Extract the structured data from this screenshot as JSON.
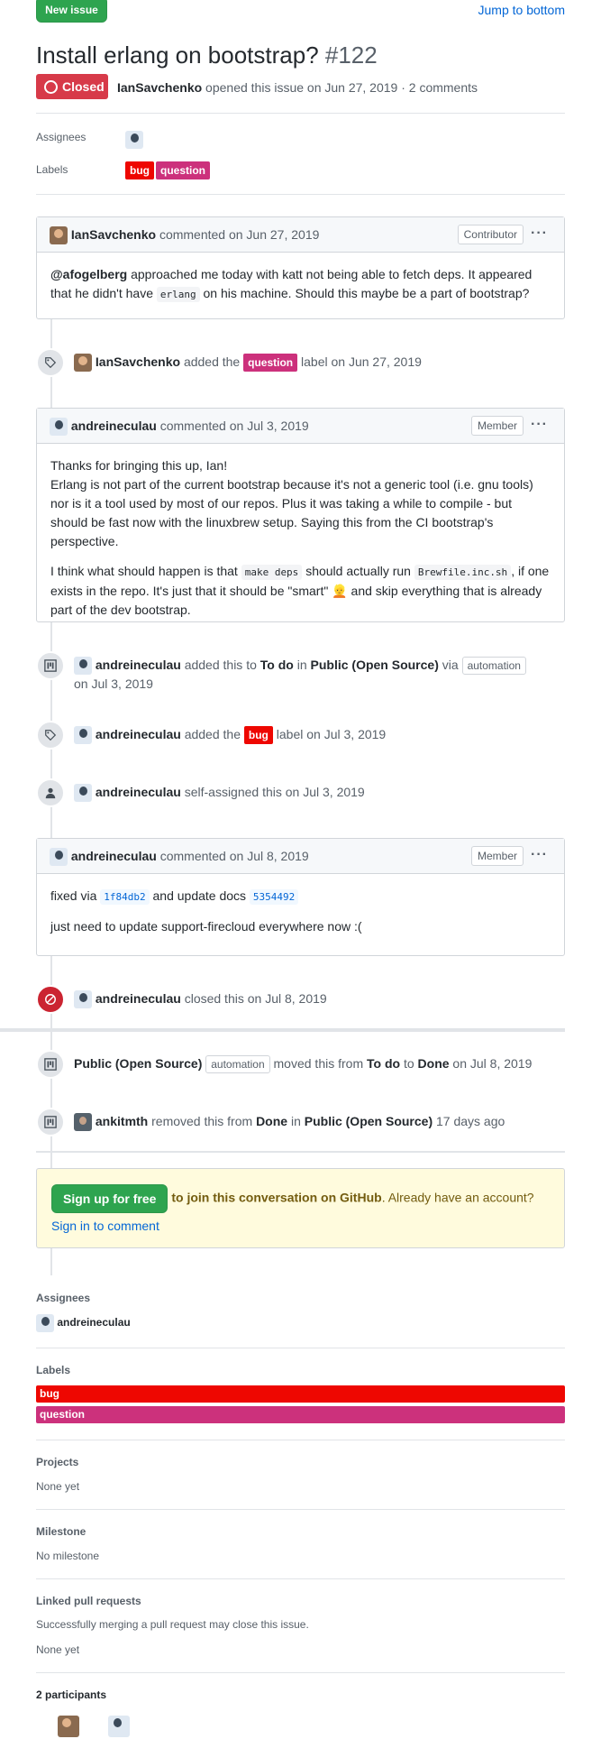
{
  "header": {
    "new_issue_label": "New issue",
    "jump_label": "Jump to bottom",
    "title": "Install erlang on bootstrap?",
    "number": "#122",
    "state_label": "Closed",
    "author": "IanSavchenko",
    "meta": "opened this issue on Jun 27, 2019 · 2 comments"
  },
  "top_meta": {
    "assignees_label": "Assignees",
    "labels_label": "Labels",
    "labels": [
      {
        "name": "bug",
        "color": "#ee0701"
      },
      {
        "name": "question",
        "color": "#cc317c"
      }
    ]
  },
  "comment1": {
    "author": "IanSavchenko",
    "when": "commented on Jun 27, 2019",
    "badge": "Contributor",
    "mention": "@afogelberg",
    "t1": "approached me today with katt not being able to fetch deps. It appeared that he didn't have",
    "code1": "erlang",
    "t2": "on his machine. Should this maybe be a part of bootstrap?"
  },
  "event_label_question": {
    "author": "IanSavchenko",
    "t1": "added the",
    "label": "question",
    "t2": "label on Jun 27, 2019"
  },
  "comment2": {
    "author": "andreineculau",
    "when": "commented on Jul 3, 2019",
    "badge": "Member",
    "p1a": "Thanks for bringing this up, Ian!",
    "p1b": "Erlang is not part of the current bootstrap because it's not a generic tool (i.e. gnu tools) nor is it a tool used by most of our repos. Plus it was taking a while to compile - but should be fast now with the linuxbrew setup. Saying this from the CI bootstrap's perspective.",
    "p2a": "I think what should happen is that",
    "p2code1": "make deps",
    "p2b": "should actually run",
    "p2code2": "Brewfile.inc.sh",
    "p2c": ", if one exists in the repo. It's just that it should be \"smart\"",
    "emoji": "👱",
    "p2d": "and skip everything that is already part of the dev bootstrap."
  },
  "event_project_add": {
    "author": "andreineculau",
    "t1": "added this to",
    "column": "To do",
    "t2": "in",
    "project": "Public (Open Source)",
    "t3": "via",
    "via": "automation",
    "date": "on Jul 3, 2019"
  },
  "event_label_bug": {
    "author": "andreineculau",
    "t1": "added the",
    "label": "bug",
    "t2": "label on Jul 3, 2019"
  },
  "event_assign": {
    "author": "andreineculau",
    "text": "self-assigned this on Jul 3, 2019"
  },
  "comment3": {
    "author": "andreineculau",
    "when": "commented on Jul 8, 2019",
    "badge": "Member",
    "t1": "fixed via",
    "sha1": "1f84db2",
    "t2": "and update docs",
    "sha2": "5354492",
    "p2": "just need to update support-firecloud everywhere now :("
  },
  "event_closed": {
    "author": "andreineculau",
    "text": "closed this on Jul 8, 2019"
  },
  "event_moved": {
    "project": "Public (Open Source)",
    "via": "automation",
    "t1": "moved this from",
    "from": "To do",
    "t2": "to",
    "to": "Done",
    "t3": "on Jul 8, 2019"
  },
  "event_removed": {
    "author": "ankitmth",
    "t1": "removed this from",
    "from": "Done",
    "t2": "in",
    "project": "Public (Open Source)",
    "t3": "17 days ago"
  },
  "signup": {
    "button": "Sign up for free",
    "t1": "to join this conversation on GitHub",
    "t2": ". Already have an account?",
    "link": "Sign in to comment"
  },
  "sidebar": {
    "assignees_label": "Assignees",
    "assignee": "andreineculau",
    "labels_label": "Labels",
    "labels": [
      {
        "name": "bug",
        "color": "#ee0701"
      },
      {
        "name": "question",
        "color": "#cc317c"
      }
    ],
    "projects_label": "Projects",
    "projects_value": "None yet",
    "milestone_label": "Milestone",
    "milestone_value": "No milestone",
    "linked_label": "Linked pull requests",
    "linked_desc": "Successfully merging a pull request may close this issue.",
    "linked_value": "None yet",
    "participants_label": "2 participants"
  }
}
